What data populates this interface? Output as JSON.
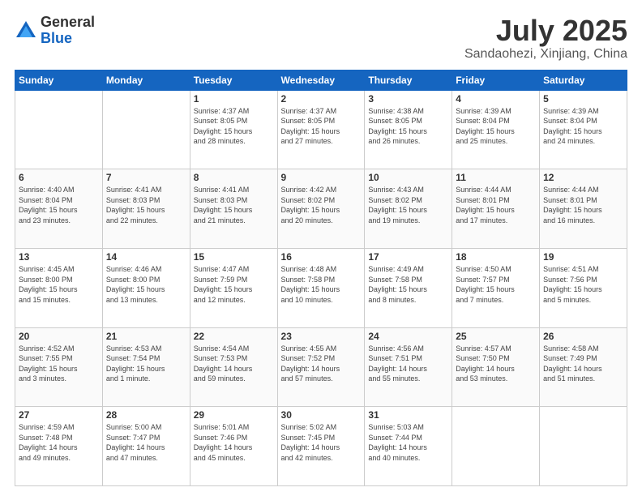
{
  "logo": {
    "general": "General",
    "blue": "Blue"
  },
  "title": "July 2025",
  "subtitle": "Sandaohezi, Xinjiang, China",
  "calendar": {
    "headers": [
      "Sunday",
      "Monday",
      "Tuesday",
      "Wednesday",
      "Thursday",
      "Friday",
      "Saturday"
    ],
    "weeks": [
      [
        {
          "day": "",
          "info": ""
        },
        {
          "day": "",
          "info": ""
        },
        {
          "day": "1",
          "info": "Sunrise: 4:37 AM\nSunset: 8:05 PM\nDaylight: 15 hours\nand 28 minutes."
        },
        {
          "day": "2",
          "info": "Sunrise: 4:37 AM\nSunset: 8:05 PM\nDaylight: 15 hours\nand 27 minutes."
        },
        {
          "day": "3",
          "info": "Sunrise: 4:38 AM\nSunset: 8:05 PM\nDaylight: 15 hours\nand 26 minutes."
        },
        {
          "day": "4",
          "info": "Sunrise: 4:39 AM\nSunset: 8:04 PM\nDaylight: 15 hours\nand 25 minutes."
        },
        {
          "day": "5",
          "info": "Sunrise: 4:39 AM\nSunset: 8:04 PM\nDaylight: 15 hours\nand 24 minutes."
        }
      ],
      [
        {
          "day": "6",
          "info": "Sunrise: 4:40 AM\nSunset: 8:04 PM\nDaylight: 15 hours\nand 23 minutes."
        },
        {
          "day": "7",
          "info": "Sunrise: 4:41 AM\nSunset: 8:03 PM\nDaylight: 15 hours\nand 22 minutes."
        },
        {
          "day": "8",
          "info": "Sunrise: 4:41 AM\nSunset: 8:03 PM\nDaylight: 15 hours\nand 21 minutes."
        },
        {
          "day": "9",
          "info": "Sunrise: 4:42 AM\nSunset: 8:02 PM\nDaylight: 15 hours\nand 20 minutes."
        },
        {
          "day": "10",
          "info": "Sunrise: 4:43 AM\nSunset: 8:02 PM\nDaylight: 15 hours\nand 19 minutes."
        },
        {
          "day": "11",
          "info": "Sunrise: 4:44 AM\nSunset: 8:01 PM\nDaylight: 15 hours\nand 17 minutes."
        },
        {
          "day": "12",
          "info": "Sunrise: 4:44 AM\nSunset: 8:01 PM\nDaylight: 15 hours\nand 16 minutes."
        }
      ],
      [
        {
          "day": "13",
          "info": "Sunrise: 4:45 AM\nSunset: 8:00 PM\nDaylight: 15 hours\nand 15 minutes."
        },
        {
          "day": "14",
          "info": "Sunrise: 4:46 AM\nSunset: 8:00 PM\nDaylight: 15 hours\nand 13 minutes."
        },
        {
          "day": "15",
          "info": "Sunrise: 4:47 AM\nSunset: 7:59 PM\nDaylight: 15 hours\nand 12 minutes."
        },
        {
          "day": "16",
          "info": "Sunrise: 4:48 AM\nSunset: 7:58 PM\nDaylight: 15 hours\nand 10 minutes."
        },
        {
          "day": "17",
          "info": "Sunrise: 4:49 AM\nSunset: 7:58 PM\nDaylight: 15 hours\nand 8 minutes."
        },
        {
          "day": "18",
          "info": "Sunrise: 4:50 AM\nSunset: 7:57 PM\nDaylight: 15 hours\nand 7 minutes."
        },
        {
          "day": "19",
          "info": "Sunrise: 4:51 AM\nSunset: 7:56 PM\nDaylight: 15 hours\nand 5 minutes."
        }
      ],
      [
        {
          "day": "20",
          "info": "Sunrise: 4:52 AM\nSunset: 7:55 PM\nDaylight: 15 hours\nand 3 minutes."
        },
        {
          "day": "21",
          "info": "Sunrise: 4:53 AM\nSunset: 7:54 PM\nDaylight: 15 hours\nand 1 minute."
        },
        {
          "day": "22",
          "info": "Sunrise: 4:54 AM\nSunset: 7:53 PM\nDaylight: 14 hours\nand 59 minutes."
        },
        {
          "day": "23",
          "info": "Sunrise: 4:55 AM\nSunset: 7:52 PM\nDaylight: 14 hours\nand 57 minutes."
        },
        {
          "day": "24",
          "info": "Sunrise: 4:56 AM\nSunset: 7:51 PM\nDaylight: 14 hours\nand 55 minutes."
        },
        {
          "day": "25",
          "info": "Sunrise: 4:57 AM\nSunset: 7:50 PM\nDaylight: 14 hours\nand 53 minutes."
        },
        {
          "day": "26",
          "info": "Sunrise: 4:58 AM\nSunset: 7:49 PM\nDaylight: 14 hours\nand 51 minutes."
        }
      ],
      [
        {
          "day": "27",
          "info": "Sunrise: 4:59 AM\nSunset: 7:48 PM\nDaylight: 14 hours\nand 49 minutes."
        },
        {
          "day": "28",
          "info": "Sunrise: 5:00 AM\nSunset: 7:47 PM\nDaylight: 14 hours\nand 47 minutes."
        },
        {
          "day": "29",
          "info": "Sunrise: 5:01 AM\nSunset: 7:46 PM\nDaylight: 14 hours\nand 45 minutes."
        },
        {
          "day": "30",
          "info": "Sunrise: 5:02 AM\nSunset: 7:45 PM\nDaylight: 14 hours\nand 42 minutes."
        },
        {
          "day": "31",
          "info": "Sunrise: 5:03 AM\nSunset: 7:44 PM\nDaylight: 14 hours\nand 40 minutes."
        },
        {
          "day": "",
          "info": ""
        },
        {
          "day": "",
          "info": ""
        }
      ]
    ]
  }
}
